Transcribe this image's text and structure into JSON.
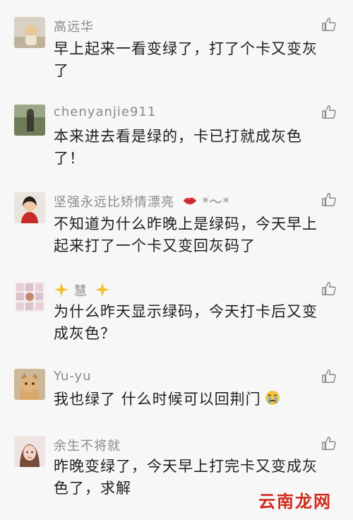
{
  "comments": [
    {
      "nickname": "高远华",
      "text": "早上起来一看变绿了，打了个卡又变灰了"
    },
    {
      "nickname": "chenyanjie911",
      "text": "本来进去看是绿的，卡已打就成灰色了！"
    },
    {
      "nickname": "坚强永远比矫情漂亮",
      "nickname_suffix": "*～*",
      "text": "不知道为什么昨晚上是绿码，今天早上起来打了一个卡又变回灰码了"
    },
    {
      "nickname": "慧",
      "text": "为什么昨天显示绿码，今天打卡后又变成灰色？"
    },
    {
      "nickname": "Yu-yu",
      "text": "我也绿了 什么时候可以回荆门"
    },
    {
      "nickname": "余生不将就",
      "text": "昨晚变绿了，今天早上打完卡又变成灰色了，求解"
    }
  ],
  "icons": {
    "like": "thumbs-up-icon",
    "lips": "lips-emoji-icon",
    "sparkle": "sparkle-emoji-icon",
    "cry": "crying-emoji-icon"
  },
  "colors": {
    "nickname": "#8a8a8a",
    "text": "#1f1f1f",
    "like": "#8a8a8a",
    "watermark": "#d22a1e"
  },
  "watermark": "云南龙网"
}
